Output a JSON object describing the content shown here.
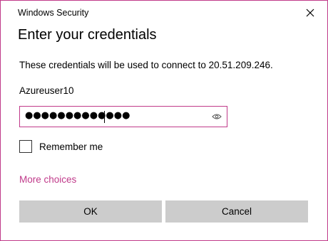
{
  "window": {
    "title": "Windows Security",
    "close_icon": "close-icon"
  },
  "dialog": {
    "heading": "Enter your credentials",
    "description": "These credentials will be used to connect to 20.51.209.246.",
    "username": "Azureuser10",
    "password": {
      "masked_value": "●●●●●●●●●●●●●",
      "reveal_icon": "eye-icon"
    },
    "remember_me": {
      "label": "Remember me",
      "checked": false
    },
    "more_choices": "More choices",
    "buttons": {
      "ok": "OK",
      "cancel": "Cancel"
    }
  },
  "colors": {
    "accent": "#c03a8a",
    "button_bg": "#cccccc",
    "text": "#000000"
  }
}
